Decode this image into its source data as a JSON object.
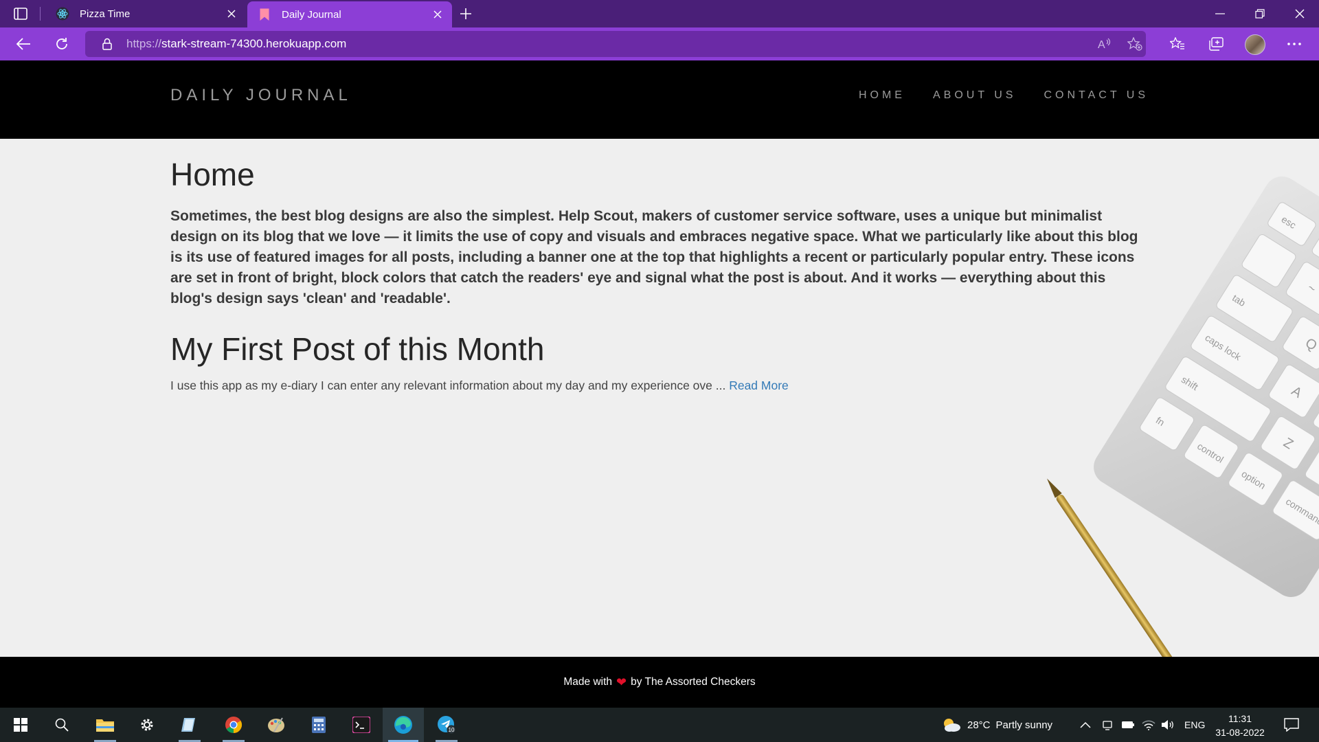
{
  "browser": {
    "tabs": [
      {
        "title": "Pizza Time",
        "icon": "react-icon"
      },
      {
        "title": "Daily Journal",
        "icon": "bookmark-icon"
      }
    ],
    "address": {
      "scheme": "https://",
      "host": "stark-stream-74300.herokuapp.com"
    }
  },
  "site": {
    "brand": "DAILY JOURNAL",
    "nav": [
      "HOME",
      "ABOUT US",
      "CONTACT US"
    ],
    "home": {
      "title": "Home",
      "intro": "Sometimes, the best blog designs are also the simplest. Help Scout, makers of customer service software, uses a unique but minimalist design on its blog that we love — it limits the use of copy and visuals and embraces negative space. What we particularly like about this blog is its use of featured images for all posts, including a banner one at the top that highlights a recent or particularly popular entry. These icons are set in front of bright, block colors that catch the readers' eye and signal what the post is about. And it works — everything about this blog's design says 'clean' and 'readable'."
    },
    "post": {
      "title": "My First Post of this Month",
      "excerpt": "I use this app as my e-diary I can enter any relevant information about my day and my experience ove ... ",
      "read_more": "Read More"
    },
    "footer": {
      "prefix": "Made with",
      "suffix": "by The Assorted Checkers"
    }
  },
  "taskbar": {
    "weather": {
      "temp": "28°C",
      "condition": "Partly sunny"
    },
    "language": "ENG",
    "time": "11:31",
    "date": "31-08-2022",
    "telegram_badge": "10"
  },
  "colors": {
    "tab_bar": "#4a1f78",
    "active_tab": "#8c3ed6",
    "link": "#337ab7",
    "heart": "#e0102a"
  }
}
